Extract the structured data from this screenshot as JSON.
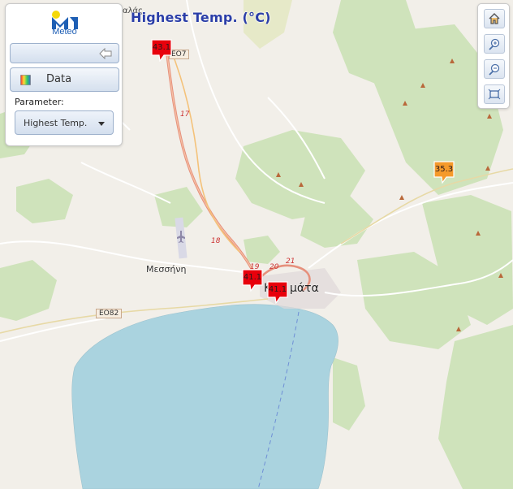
{
  "map": {
    "title": "Highest Temp. (°C)",
    "places": {
      "top_partial": "αλάς",
      "messini": "Μεσσήνη",
      "kalamata_left": "Κ",
      "kalamata_right": "μάτα"
    },
    "roads": {
      "eo7": "ΕΟ7",
      "eo82": "ΕΟ82",
      "r17": "17",
      "r18": "18",
      "r19": "19",
      "r20": "20",
      "r21": "21"
    },
    "markers": [
      {
        "label": "43.1",
        "color": "#e8000c"
      },
      {
        "label": "41.1",
        "color": "#e8000c"
      },
      {
        "label": "41.1",
        "color": "#e8000c"
      },
      {
        "label": "35.3",
        "color": "#f59a2b"
      }
    ]
  },
  "panel": {
    "logo_text": "Meteo",
    "data_button": "Data",
    "parameter_label": "Parameter:",
    "parameter_value": "Highest Temp."
  },
  "toolbar": {
    "home": "home-icon",
    "zoom_in": "zoom-in-icon",
    "zoom_out": "zoom-out-icon",
    "extent": "full-extent-icon"
  },
  "colors": {
    "land": "#f2efe9",
    "forest": "#c9dfb4",
    "sea": "#aad3df",
    "title": "#2b3ea8",
    "hot": "#e8000c",
    "warm": "#f59a2b"
  }
}
